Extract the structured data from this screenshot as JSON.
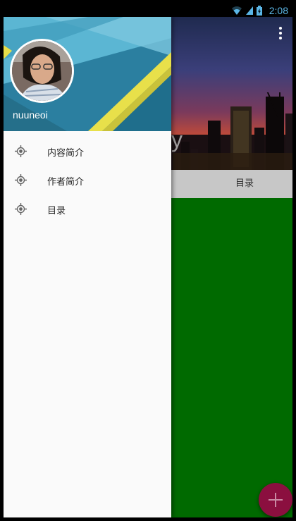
{
  "status_bar": {
    "time": "2:08",
    "icons": [
      "wifi-icon",
      "signal-icon",
      "battery-charging-icon"
    ]
  },
  "drawer": {
    "username": "nuuneoi",
    "items": [
      {
        "label": "内容简介",
        "icon": "locate-icon"
      },
      {
        "label": "作者简介",
        "icon": "locate-icon"
      },
      {
        "label": "目录",
        "icon": "locate-icon"
      }
    ]
  },
  "main": {
    "hero_partial_text": "y",
    "tabs": [
      {
        "label": ""
      },
      {
        "label": ""
      },
      {
        "label": "目录"
      }
    ],
    "fab_icon": "plus-icon"
  },
  "colors": {
    "content_green": "#006a00",
    "fab": "#8b0f3f",
    "tab_indicator": "#e91e63",
    "status_accent": "#5bb6e6"
  }
}
